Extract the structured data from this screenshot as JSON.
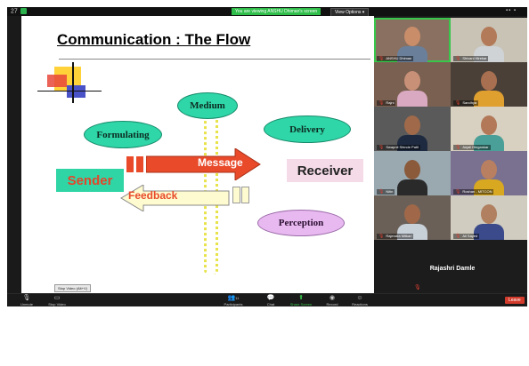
{
  "topbar": {
    "meeting_id": "27",
    "sharing_text": "You are viewing ANSHU Dhiman's screen",
    "view_options": "View Options ▾",
    "grid_icons": "▪▪ ▪"
  },
  "slide": {
    "title": "Communication : The Flow",
    "medium": "Medium",
    "formulating": "Formulating",
    "delivery": "Delivery",
    "perception": "Perception",
    "message": "Message",
    "feedback": "Feedback",
    "sender": "Sender",
    "receiver": "Receiver"
  },
  "participants": [
    {
      "name": "ANSHU Dhiman",
      "skin": "#c98d6a",
      "shirt": "#6a7f9a",
      "bg": "#8a7060",
      "active": true
    },
    {
      "name": "Shivani Hirekar",
      "skin": "#b27a58",
      "shirt": "#cfd3d6",
      "bg": "#c9c3b6",
      "active": false
    },
    {
      "name": "Rajni",
      "skin": "#c99078",
      "shirt": "#d8a9c0",
      "bg": "#7a6050",
      "active": false
    },
    {
      "name": "Sandhya",
      "skin": "#a87050",
      "shirt": "#e0a030",
      "bg": "#4a4038",
      "active": false
    },
    {
      "name": "Swapnil Shinde Patil",
      "skin": "#a06a4a",
      "shirt": "#1e2a40",
      "bg": "#5a5a5a",
      "active": false
    },
    {
      "name": "Anjali Hingankar",
      "skin": "#b27858",
      "shirt": "#4aa098",
      "bg": "#d8d0c0",
      "active": false
    },
    {
      "name": "Nitin",
      "skin": "#8a5a3a",
      "shirt": "#2a2a2a",
      "bg": "#9aa8b0",
      "active": false
    },
    {
      "name": "Roshan - MITCON",
      "skin": "#b88060",
      "shirt": "#d8a820",
      "bg": "#7a7090",
      "active": false
    },
    {
      "name": "Rajendra Mitkari",
      "skin": "#a06848",
      "shirt": "#c8d0d8",
      "bg": "#6a6058",
      "active": false
    },
    {
      "name": "Ali Sayed",
      "skin": "#b08060",
      "shirt": "#3a4a8a",
      "bg": "#d0ccc0",
      "active": false
    }
  ],
  "featured_participant": {
    "name": "Rajashri Damle"
  },
  "tooltip": "Stop Video (Alt+V)",
  "toolbar": {
    "unmute": "Unmute",
    "stop_video": "Stop Video",
    "participants": "Participants",
    "participant_count": "11",
    "chat": "Chat",
    "share_screen": "Share Screen",
    "record": "Record",
    "reactions": "Reactions",
    "leave": "Leave"
  },
  "colors": {
    "teal": "#2ed6a8",
    "lavender": "#e8b8f0",
    "message_red": "#e84a2a",
    "zoom_green": "#37c84b",
    "leave_red": "#d23b2b"
  }
}
